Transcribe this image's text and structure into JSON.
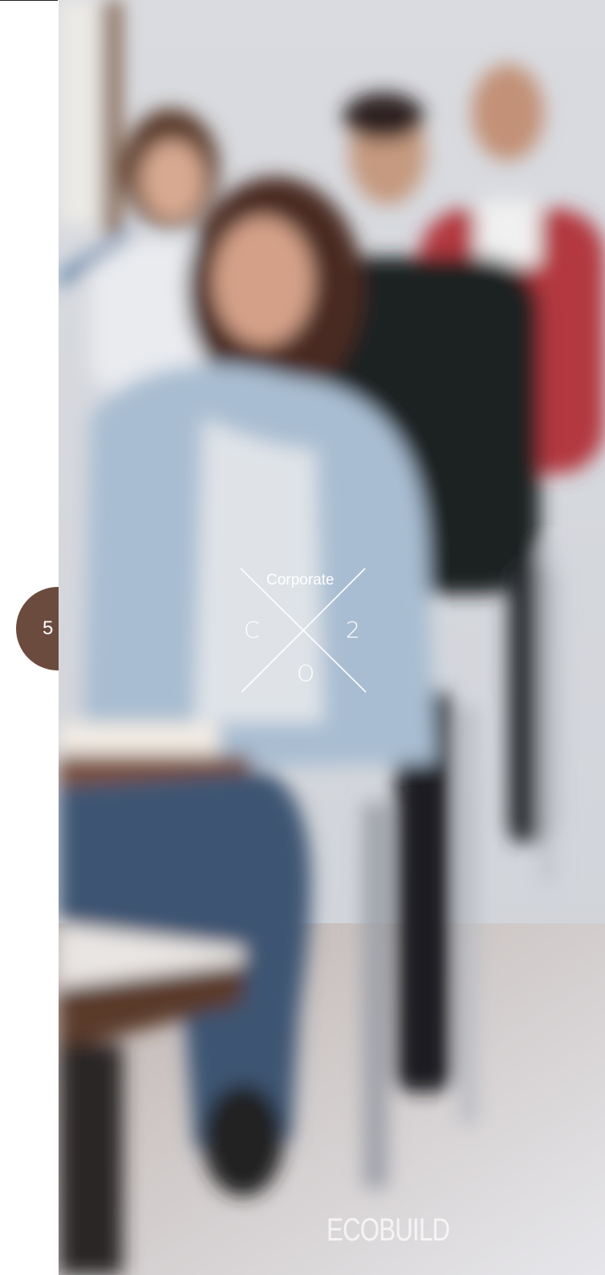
{
  "slide": {
    "page_number": "5",
    "logo": {
      "word": "Corporate",
      "letter_left": "C",
      "letter_right": "2",
      "letter_bottom": "O"
    },
    "brand": "ECOBUILD"
  },
  "colors": {
    "background": "#ffffff",
    "page_tab": "#6b4b3e",
    "logo": "#ffffff"
  },
  "icons": [
    "x-cross-logo-icon"
  ],
  "photo": {
    "subject": "students-seated-in-classroom-photo"
  }
}
